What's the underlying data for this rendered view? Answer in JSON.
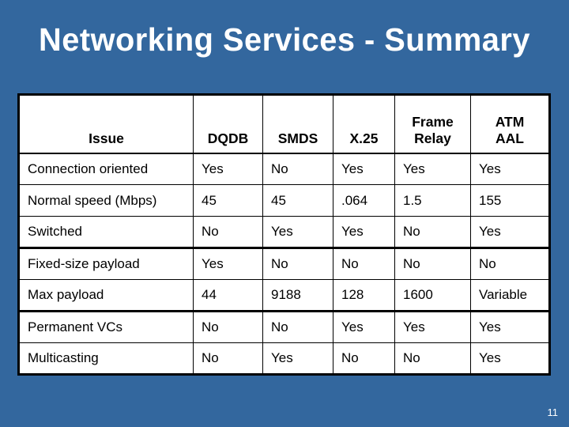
{
  "slide": {
    "title": "Networking Services - Summary",
    "page_number": "11",
    "background_color": "#33679e",
    "title_color": "#ffffff"
  },
  "table": {
    "headers": [
      {
        "lines": [
          "Issue"
        ]
      },
      {
        "lines": [
          "DQDB"
        ]
      },
      {
        "lines": [
          "SMDS"
        ]
      },
      {
        "lines": [
          "X.25"
        ]
      },
      {
        "lines": [
          "Frame",
          "Relay"
        ]
      },
      {
        "lines": [
          "ATM",
          "AAL"
        ]
      }
    ],
    "rows": [
      {
        "issue": "Connection oriented",
        "dqdb": "Yes",
        "smds": "No",
        "x25": "Yes",
        "frame_relay": "Yes",
        "atm_aal": "Yes"
      },
      {
        "issue": "Normal speed (Mbps)",
        "dqdb": "45",
        "smds": "45",
        "x25": ".064",
        "frame_relay": "1.5",
        "atm_aal": "155"
      },
      {
        "issue": "Switched",
        "dqdb": "No",
        "smds": "Yes",
        "x25": "Yes",
        "frame_relay": "No",
        "atm_aal": "Yes"
      },
      {
        "issue": "Fixed-size payload",
        "dqdb": "Yes",
        "smds": "No",
        "x25": "No",
        "frame_relay": "No",
        "atm_aal": "No"
      },
      {
        "issue": "Max payload",
        "dqdb": "44",
        "smds": "9188",
        "x25": "128",
        "frame_relay": "1600",
        "atm_aal": "Variable"
      },
      {
        "issue": "Permanent VCs",
        "dqdb": "No",
        "smds": "No",
        "x25": "Yes",
        "frame_relay": "Yes",
        "atm_aal": "Yes"
      },
      {
        "issue": "Multicasting",
        "dqdb": "No",
        "smds": "Yes",
        "x25": "No",
        "frame_relay": "No",
        "atm_aal": "Yes"
      }
    ]
  }
}
